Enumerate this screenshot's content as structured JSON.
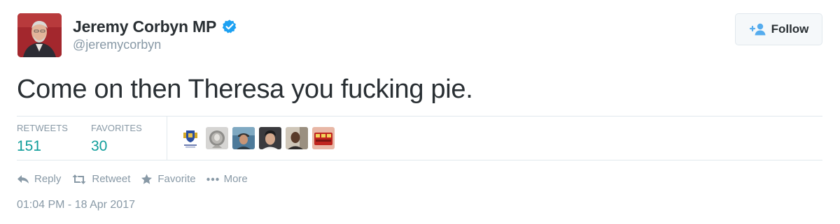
{
  "user": {
    "display_name": "Jeremy Corbyn MP",
    "handle": "@jeremycorbyn",
    "verified": true,
    "avatar_icon": "profile-photo"
  },
  "follow_button": {
    "label": "Follow",
    "icon": "follow-user-icon"
  },
  "tweet": {
    "text": "Come on then Theresa you fucking pie.",
    "timestamp": "01:04 PM - 18 Apr 2017"
  },
  "stats": {
    "retweets_label": "RETWEETS",
    "retweets_count": "151",
    "favorites_label": "FAVORITES",
    "favorites_count": "30"
  },
  "favoriters": [
    {
      "name": "favoriter-avatar-crest"
    },
    {
      "name": "favoriter-avatar-statue"
    },
    {
      "name": "favoriter-avatar-man-cap"
    },
    {
      "name": "favoriter-avatar-man-dark-hair"
    },
    {
      "name": "favoriter-avatar-man-dark-skin"
    },
    {
      "name": "favoriter-avatar-red-bus"
    }
  ],
  "actions": {
    "reply": "Reply",
    "retweet": "Retweet",
    "favorite": "Favorite",
    "more": "More"
  },
  "colors": {
    "text": "#292f33",
    "muted": "#8899a6",
    "stat_value": "#0f9d9a",
    "verified": "#1da1f2",
    "follow_icon": "#55acee",
    "divider": "#e1e8ed"
  }
}
